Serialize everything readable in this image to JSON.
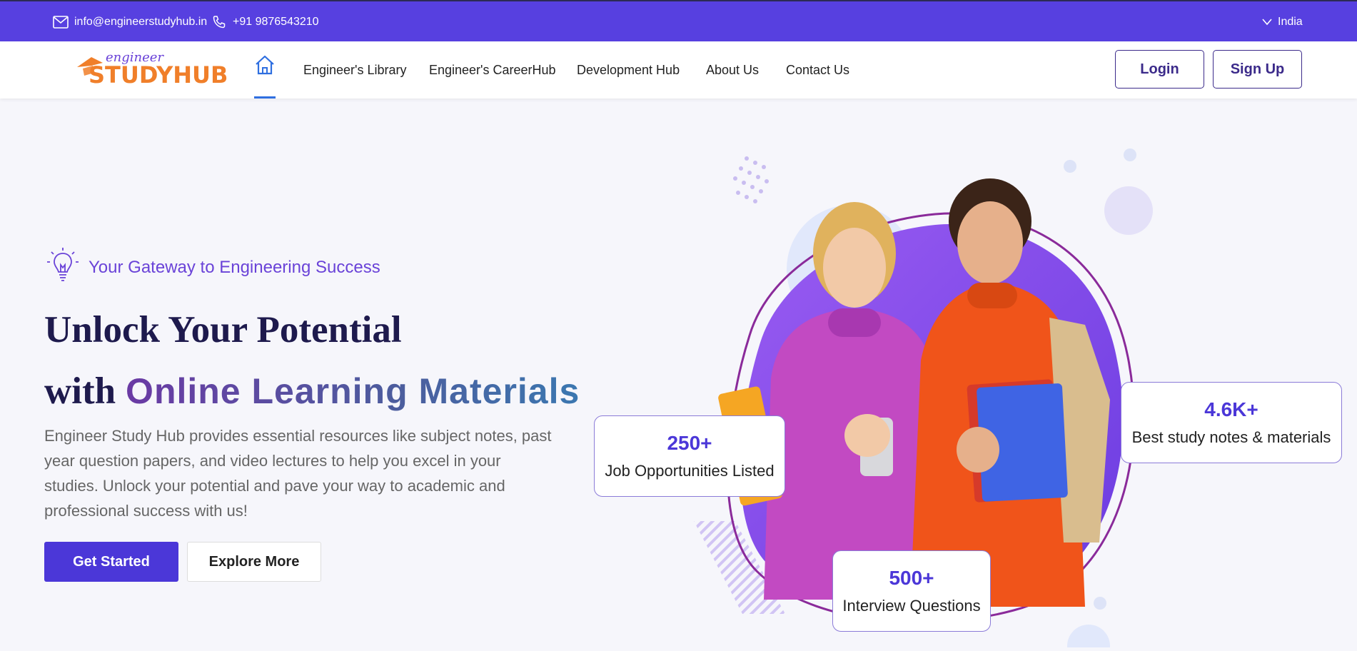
{
  "topbar": {
    "email": "info@engineerstudyhub.in",
    "phone": "+91 9876543210",
    "region": "India"
  },
  "logo": {
    "small": "engineer",
    "big": "STUDYHUB"
  },
  "nav": {
    "links": [
      "Engineer's Library",
      "Engineer's CareerHub",
      "Development Hub",
      "About Us",
      "Contact Us"
    ],
    "login": "Login",
    "signup": "Sign Up"
  },
  "hero": {
    "tagline": "Your Gateway to Engineering Success",
    "title_line1": "Unlock Your Potential",
    "title_with": "with",
    "title_highlight": "Online Learning Materials",
    "description": "Engineer Study Hub provides essential resources like subject notes, past year question papers, and video lectures to help you excel in your studies. Unlock your potential and pave your way to academic and professional success with us!",
    "primary_button": "Get Started",
    "secondary_button": "Explore More"
  },
  "stats": [
    {
      "value": "250+",
      "label": "Job Opportunities Listed"
    },
    {
      "value": "4.6K+",
      "label": "Best study notes & materials"
    },
    {
      "value": "500+",
      "label": "Interview Questions"
    }
  ],
  "colors": {
    "topbar": "#5740e0",
    "accent": "#4b37d8",
    "logo_orange": "#f07f2a",
    "tagline_purple": "#6a43d8",
    "heading_dark": "#1e1a4d"
  }
}
